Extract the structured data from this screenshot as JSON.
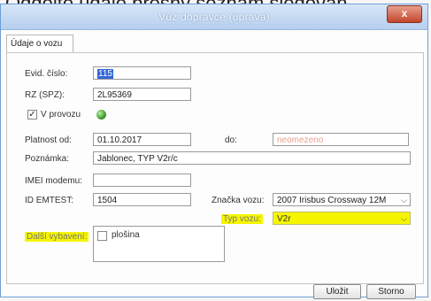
{
  "caption_text": "Oddělte údaje přesný seznam sledovan",
  "window": {
    "title": "Vůz dopravce (úprava)",
    "close_label": "x"
  },
  "tabs": [
    "Údaje o vozu"
  ],
  "form": {
    "evid_cislo": {
      "label": "Evid. číslo:",
      "value": "115"
    },
    "rz": {
      "label": "RZ (SPZ):",
      "value": "2L95369"
    },
    "v_provozu": {
      "label": "V provozu",
      "checked": true,
      "status_color": "#3f9a2c"
    },
    "platnost_od": {
      "label": "Platnost od:",
      "value": "01.10.2017"
    },
    "do": {
      "label": "do:",
      "placeholder": "neomezeno"
    },
    "poznamka": {
      "label": "Poznámka:",
      "value": "Jablonec, TYP V2r/c"
    },
    "imei": {
      "label": "IMEI modemu:",
      "value": ""
    },
    "id_emtest": {
      "label": "ID EMTEST:",
      "value": "1504"
    },
    "znacka": {
      "label": "Značka vozu:",
      "value": "2007 Irisbus Crossway 12M"
    },
    "typ_vozu": {
      "label": "Typ vozu:",
      "value": "V2r"
    },
    "dalsi_vybaveni": {
      "label": "Další vybavení:",
      "items": [
        {
          "label": "plošina",
          "checked": false
        }
      ]
    }
  },
  "buttons": {
    "save": "Uložit",
    "cancel": "Storno"
  },
  "colors": {
    "highlight": "#f5f500",
    "selection": "#3367d6",
    "titlebar": "#b6cfee"
  }
}
